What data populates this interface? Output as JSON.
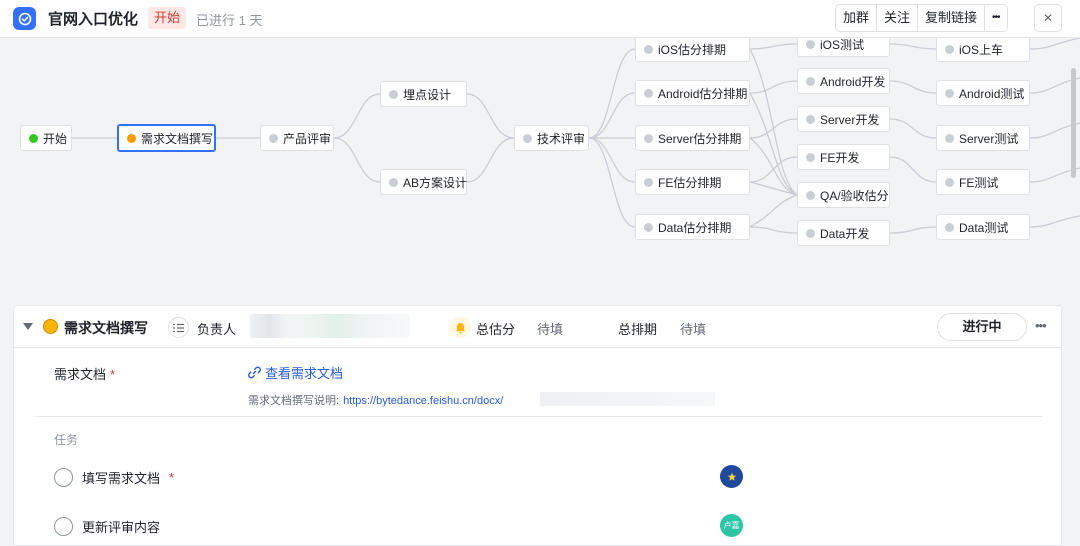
{
  "header": {
    "title": "官网入口优化",
    "status": "开始",
    "elapsed": "已进行 1 天",
    "actions": [
      "加群",
      "关注",
      "复制链接"
    ],
    "more": "•••",
    "close": "✕"
  },
  "flow": {
    "start": "开始",
    "req_doc": "需求文档撰写",
    "product_review": "产品评审",
    "tracking_design": "埋点设计",
    "ab_design": "AB方案设计",
    "tech_review": "技术评审",
    "ios_estimate": "iOS估分排期",
    "android_estimate": "Android估分排期",
    "server_estimate": "Server估分排期",
    "fe_estimate": "FE估分排期",
    "data_estimate": "Data估分排期",
    "ios_test": "iOS测试",
    "android_dev": "Android开发",
    "server_dev": "Server开发",
    "fe_dev": "FE开发",
    "qa_estimate": "QA/验收估分",
    "data_dev": "Data开发",
    "ios_release": "iOS上车",
    "android_test": "Android测试",
    "server_test": "Server测试",
    "fe_test": "FE测试",
    "data_test": "Data测试"
  },
  "panel": {
    "stage_name": "需求文档撰写",
    "assignee_label": "负责人",
    "total_estimate_label": "总估分",
    "total_estimate_value": "待填",
    "total_schedule_label": "总排期",
    "total_schedule_value": "待填",
    "status_button": "进行中",
    "more": "•••",
    "doc_field_label": "需求文档",
    "required_mark": "*",
    "doc_link": "查看需求文档",
    "doc_desc_label": "需求文档撰写说明:",
    "doc_url": "https://bytedance.feishu.cn/docx/",
    "tasks_label": "任务",
    "tasks": [
      {
        "title": "填写需求文档",
        "required": "*"
      },
      {
        "title": "更新评审内容"
      }
    ],
    "avatar_initials": "卢嘉"
  },
  "colors": {
    "accent": "#3370ff",
    "status_red": "#d83931",
    "link": "#245bdb",
    "dot_green": "#34c724",
    "dot_orange": "#ff9a00"
  }
}
